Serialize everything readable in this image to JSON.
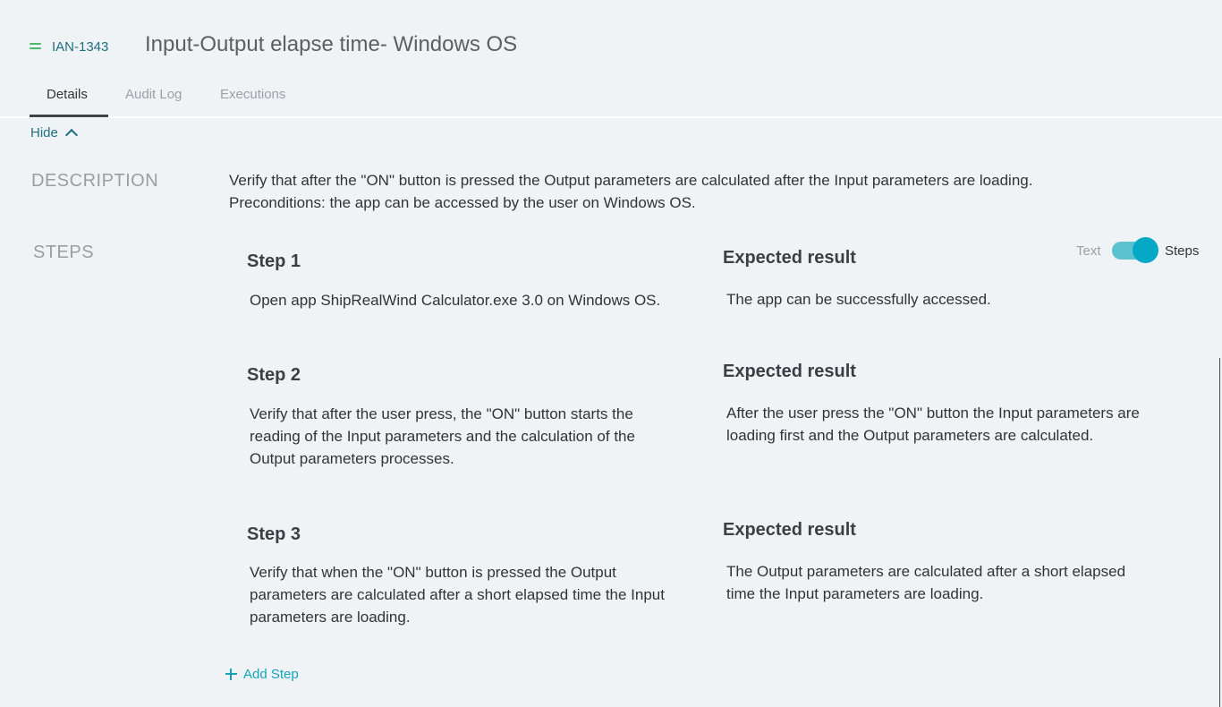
{
  "header": {
    "issue_key": "IAN-1343",
    "title": "Input-Output elapse time- Windows OS",
    "priority_icon": "equals-icon",
    "priority_color": "#4cb86b"
  },
  "tabs": [
    {
      "label": "Details",
      "active": true
    },
    {
      "label": "Audit Log",
      "active": false
    },
    {
      "label": "Executions",
      "active": false
    }
  ],
  "hide_label": "Hide",
  "description": {
    "label": "DESCRIPTION",
    "line1": "Verify that after the \"ON\" button is pressed the Output parameters are calculated after the Input parameters are loading.",
    "line2": "Preconditions: the app can be accessed by the user on Windows OS."
  },
  "steps_section": {
    "label": "STEPS",
    "toggle": {
      "left_label": "Text",
      "right_label": "Steps",
      "selected": "Steps"
    },
    "steps": [
      {
        "title": "Step 1",
        "text": "Open app ShipRealWind Calculator.exe 3.0 on Windows OS.",
        "expected_title": "Expected result",
        "expected": "The app can be successfully accessed."
      },
      {
        "title": "Step 2",
        "text": "Verify that after the user press, the \"ON\" button starts the reading of the Input parameters and the calculation of the Output parameters processes.",
        "expected_title": "Expected result",
        "expected": "After the user press the \"ON\" button the Input parameters are loading first and the Output parameters are calculated."
      },
      {
        "title": "Step 3",
        "text": "Verify that when the \"ON\" button is pressed the Output parameters are calculated after a short elapsed time the Input parameters are loading.",
        "expected_title": "Expected result",
        "expected": "The Output parameters are calculated after a short elapsed time the Input parameters are loading."
      }
    ],
    "add_step_label": "Add Step"
  },
  "colors": {
    "accent": "#17a2b8",
    "link": "#1e6f7f",
    "toggle": "#06a9c5"
  }
}
